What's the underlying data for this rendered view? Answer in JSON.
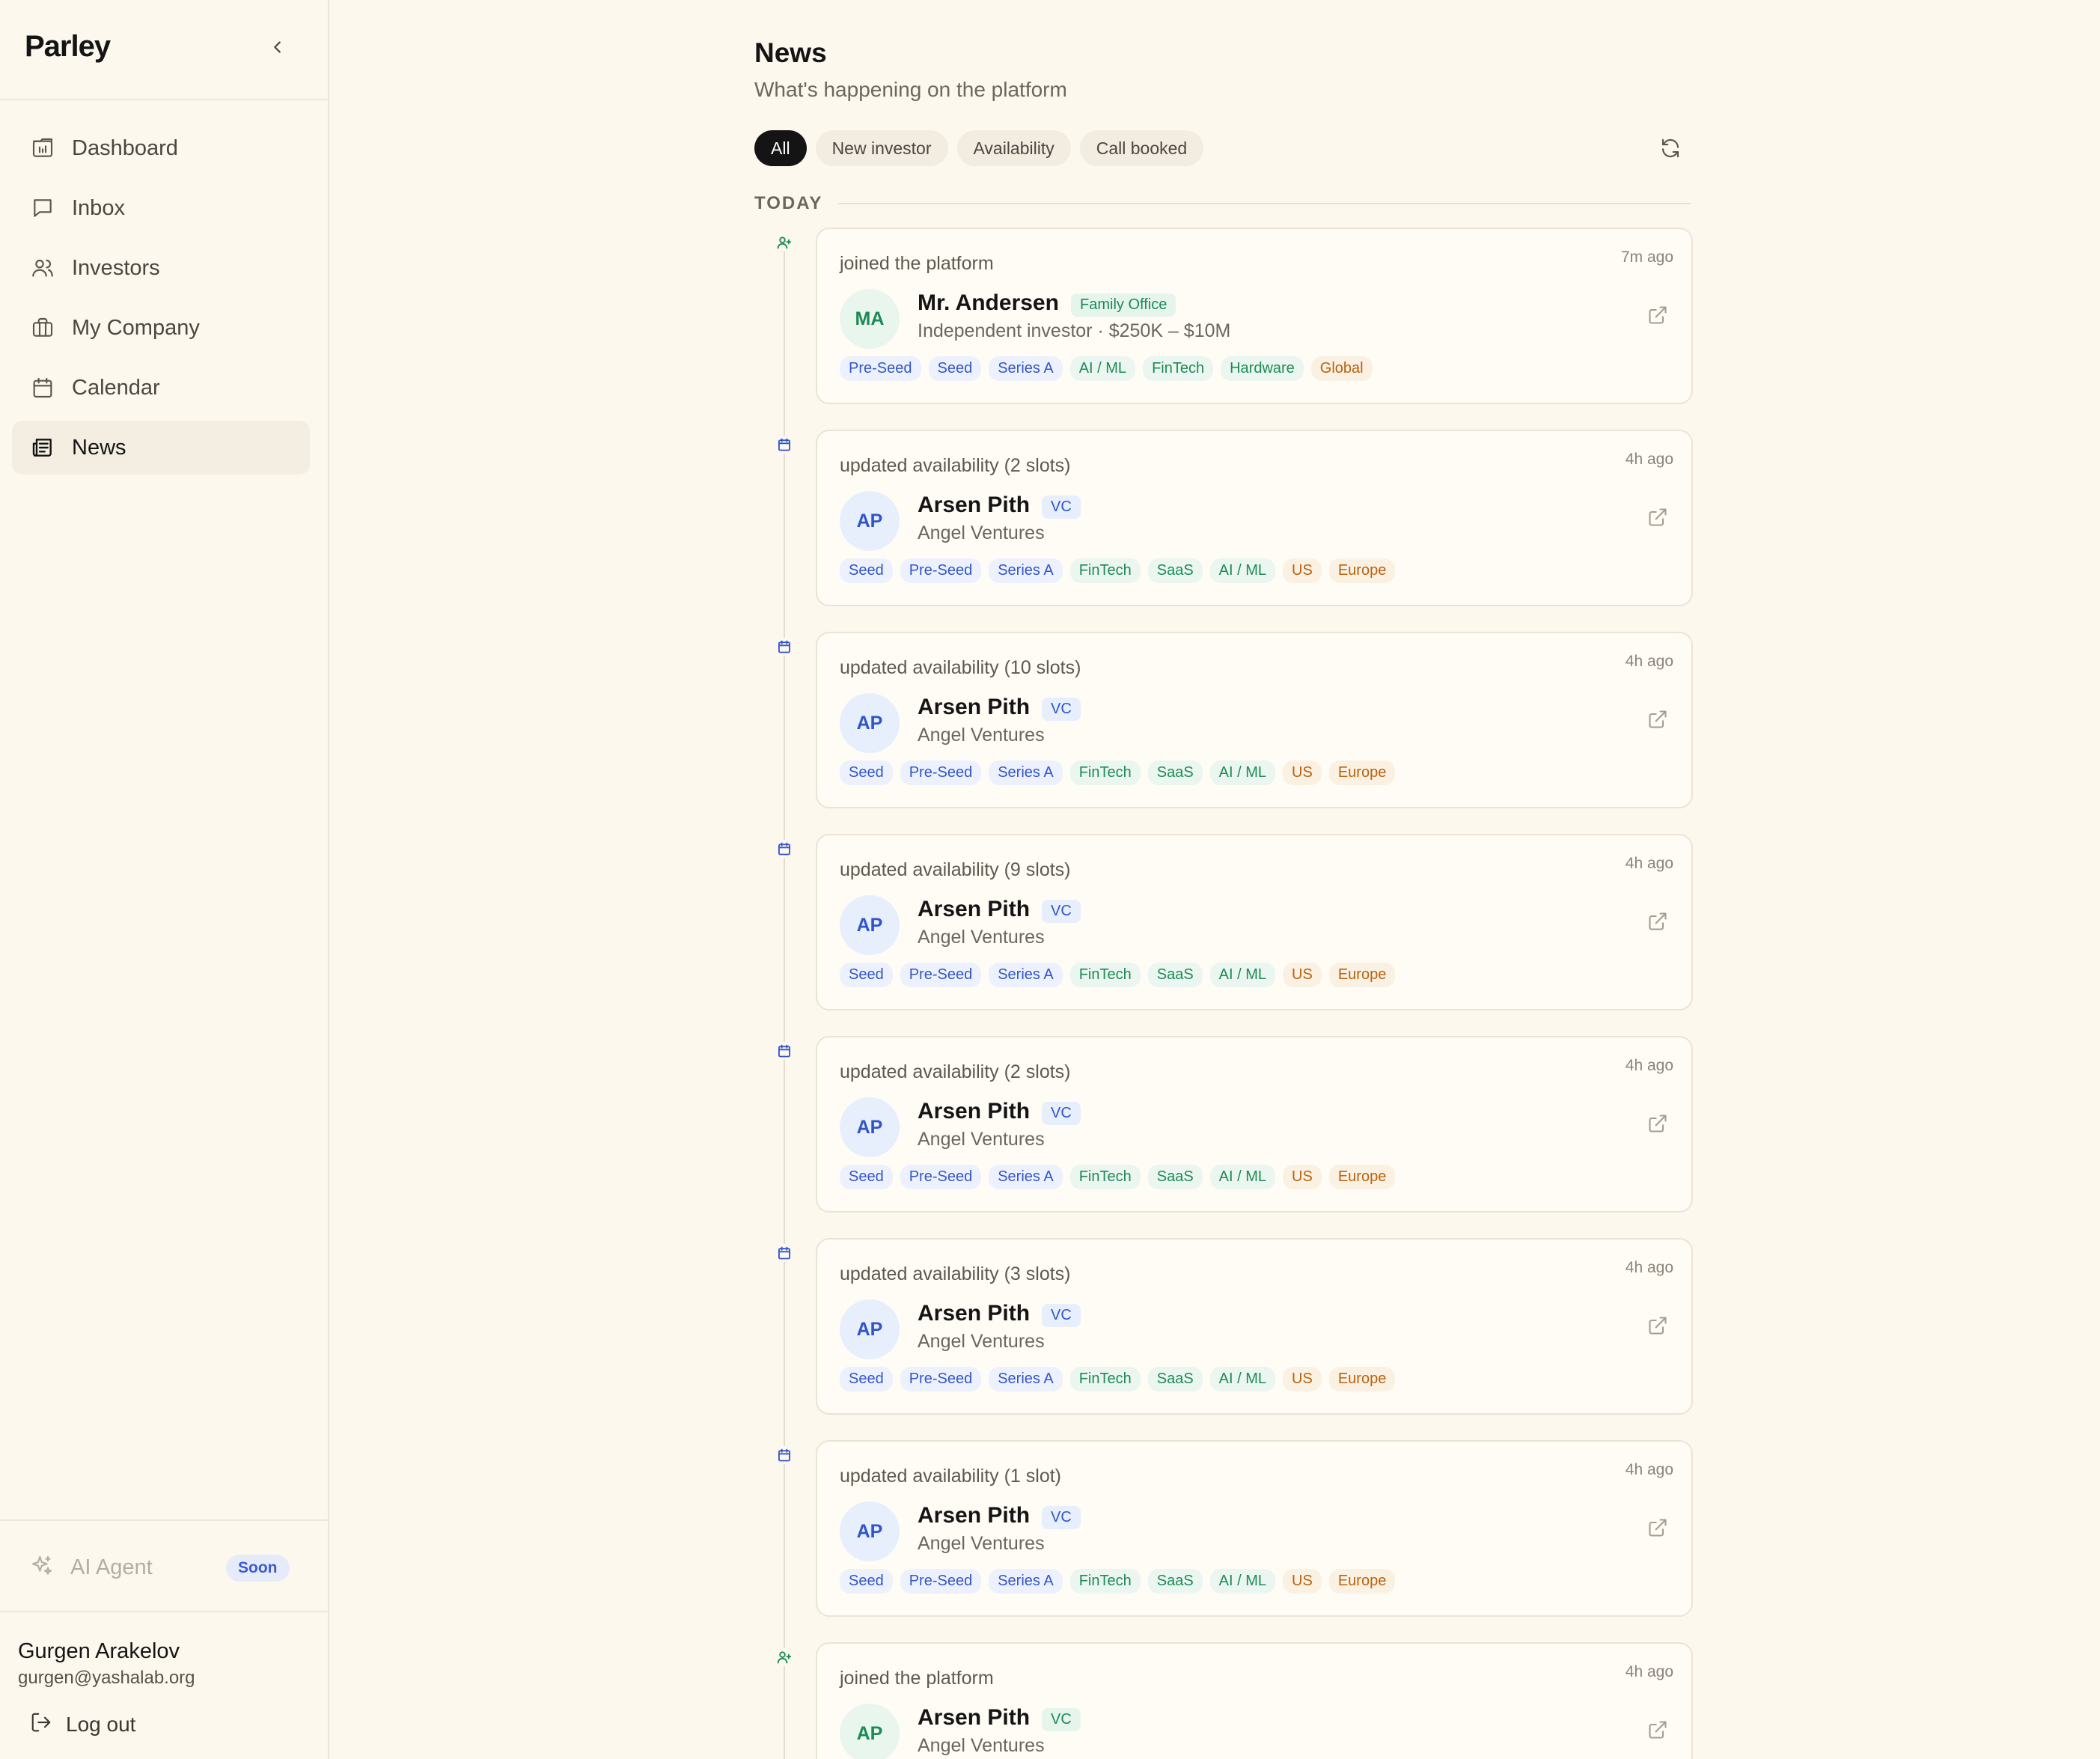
{
  "app": {
    "brand": "Parley"
  },
  "sidebar": {
    "items": [
      {
        "label": "Dashboard",
        "icon": "dashboard-icon"
      },
      {
        "label": "Inbox",
        "icon": "inbox-icon"
      },
      {
        "label": "Investors",
        "icon": "investors-icon"
      },
      {
        "label": "My Company",
        "icon": "briefcase-icon"
      },
      {
        "label": "Calendar",
        "icon": "calendar-icon"
      },
      {
        "label": "News",
        "icon": "newspaper-icon",
        "active": true
      }
    ],
    "ai_agent": {
      "label": "AI Agent",
      "badge": "Soon"
    },
    "user": {
      "name": "Gurgen Arakelov",
      "email": "gurgen@yashalab.org"
    },
    "logout_label": "Log out"
  },
  "main": {
    "title": "News",
    "subtitle": "What's happening on the platform",
    "filters": [
      "All",
      "New investor",
      "Availability",
      "Call booked"
    ],
    "active_filter": "All",
    "day_label": "TODAY"
  },
  "colors": {
    "background": "#fdf8ee",
    "active_chip": "#141414",
    "stage_tag": "#3356c9",
    "sector_tag": "#1f8a58",
    "geo_tag": "#b8620f"
  },
  "feed": [
    {
      "kind": "joined",
      "action": "joined the platform",
      "time": "7m ago",
      "initials": "MA",
      "name": "Mr. Andersen",
      "badge": "Family Office",
      "subline": "Independent investor · $250K – $10M",
      "stages": [
        "Pre-Seed",
        "Seed",
        "Series A"
      ],
      "sectors": [
        "AI / ML",
        "FinTech",
        "Hardware"
      ],
      "geos": [
        "Global"
      ]
    },
    {
      "kind": "availability",
      "action": "updated availability (2 slots)",
      "time": "4h ago",
      "initials": "AP",
      "name": "Arsen Pith",
      "badge": "VC",
      "subline": "Angel Ventures",
      "stages": [
        "Seed",
        "Pre-Seed",
        "Series A"
      ],
      "sectors": [
        "FinTech",
        "SaaS",
        "AI / ML"
      ],
      "geos": [
        "US",
        "Europe"
      ]
    },
    {
      "kind": "availability",
      "action": "updated availability (10 slots)",
      "time": "4h ago",
      "initials": "AP",
      "name": "Arsen Pith",
      "badge": "VC",
      "subline": "Angel Ventures",
      "stages": [
        "Seed",
        "Pre-Seed",
        "Series A"
      ],
      "sectors": [
        "FinTech",
        "SaaS",
        "AI / ML"
      ],
      "geos": [
        "US",
        "Europe"
      ]
    },
    {
      "kind": "availability",
      "action": "updated availability (9 slots)",
      "time": "4h ago",
      "initials": "AP",
      "name": "Arsen Pith",
      "badge": "VC",
      "subline": "Angel Ventures",
      "stages": [
        "Seed",
        "Pre-Seed",
        "Series A"
      ],
      "sectors": [
        "FinTech",
        "SaaS",
        "AI / ML"
      ],
      "geos": [
        "US",
        "Europe"
      ]
    },
    {
      "kind": "availability",
      "action": "updated availability (2 slots)",
      "time": "4h ago",
      "initials": "AP",
      "name": "Arsen Pith",
      "badge": "VC",
      "subline": "Angel Ventures",
      "stages": [
        "Seed",
        "Pre-Seed",
        "Series A"
      ],
      "sectors": [
        "FinTech",
        "SaaS",
        "AI / ML"
      ],
      "geos": [
        "US",
        "Europe"
      ]
    },
    {
      "kind": "availability",
      "action": "updated availability (3 slots)",
      "time": "4h ago",
      "initials": "AP",
      "name": "Arsen Pith",
      "badge": "VC",
      "subline": "Angel Ventures",
      "stages": [
        "Seed",
        "Pre-Seed",
        "Series A"
      ],
      "sectors": [
        "FinTech",
        "SaaS",
        "AI / ML"
      ],
      "geos": [
        "US",
        "Europe"
      ]
    },
    {
      "kind": "availability",
      "action": "updated availability (1 slot)",
      "time": "4h ago",
      "initials": "AP",
      "name": "Arsen Pith",
      "badge": "VC",
      "subline": "Angel Ventures",
      "stages": [
        "Seed",
        "Pre-Seed",
        "Series A"
      ],
      "sectors": [
        "FinTech",
        "SaaS",
        "AI / ML"
      ],
      "geos": [
        "US",
        "Europe"
      ]
    },
    {
      "kind": "joined",
      "action": "joined the platform",
      "time": "4h ago",
      "initials": "AP",
      "name": "Arsen Pith",
      "badge": "VC",
      "subline": "Angel Ventures",
      "stages": [],
      "sectors": [],
      "geos": []
    }
  ]
}
